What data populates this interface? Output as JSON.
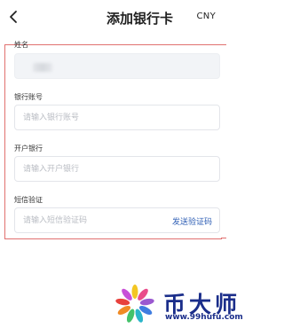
{
  "header": {
    "title": "添加银行卡",
    "currency": "CNY",
    "back_icon": "chevron-left-icon"
  },
  "form": {
    "name": {
      "label": "姓名",
      "value": ""
    },
    "account": {
      "label": "银行账号",
      "placeholder": "请输入银行账号"
    },
    "bank": {
      "label": "开户银行",
      "placeholder": "请输入开户银行"
    },
    "sms": {
      "label": "短信验证",
      "placeholder": "请输入短信验证码",
      "send_label": "发送验证码"
    }
  },
  "colors": {
    "highlight_border": "#e1706f",
    "link": "#2f5fb5",
    "watermark": "#1a2d8a"
  },
  "watermark": {
    "brand": "币大师",
    "url": "www.99hufu.com",
    "logo_icon": "flower-logo-icon"
  }
}
